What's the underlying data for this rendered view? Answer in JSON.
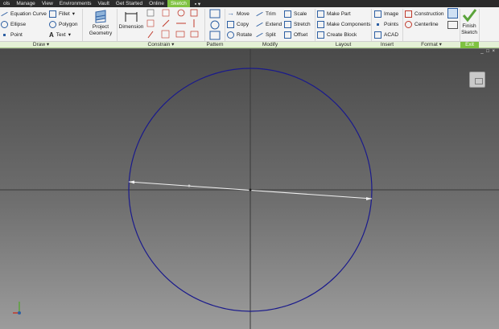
{
  "menu": {
    "tabs": [
      {
        "label": "ols",
        "active": false
      },
      {
        "label": "Manage",
        "active": false
      },
      {
        "label": "View",
        "active": false
      },
      {
        "label": "Environments",
        "active": false
      },
      {
        "label": "Vault",
        "active": false
      },
      {
        "label": "Get Started",
        "active": false
      },
      {
        "label": "Online",
        "active": false
      },
      {
        "label": "Sketch",
        "active": true
      }
    ],
    "qat_label": "▪ ▾"
  },
  "ribbon": {
    "draw": {
      "equation_curve": "Equation Curve",
      "fillet": "Fillet",
      "ellipse": "Ellipse",
      "polygon": "Polygon",
      "point": "Point",
      "text": "Text",
      "dropdown": "▾"
    },
    "project_geometry": "Project Geometry",
    "dimension": "Dimension",
    "modify": {
      "move": "Move",
      "trim": "Trim",
      "scale": "Scale",
      "copy": "Copy",
      "extend": "Extend",
      "stretch": "Stretch",
      "rotate": "Rotate",
      "split": "Split",
      "offset": "Offset"
    },
    "layout": {
      "make_part": "Make Part",
      "make_components": "Make Components",
      "create_block": "Create Block"
    },
    "insert": {
      "image": "Image",
      "points": "Points",
      "acad": "ACAD"
    },
    "format": {
      "construction": "Construction",
      "centerline": "Centerline"
    },
    "exit": {
      "finish_sketch": "Finish Sketch"
    }
  },
  "panels": [
    {
      "label": "Draw ▾",
      "active": false
    },
    {
      "label": "Constrain ▾",
      "active": false
    },
    {
      "label": "Pattern",
      "active": false
    },
    {
      "label": "Modify",
      "active": false
    },
    {
      "label": "Layout",
      "active": false
    },
    {
      "label": "Insert",
      "active": false
    },
    {
      "label": "Format ▾",
      "active": false
    },
    {
      "label": "Exit",
      "active": true
    }
  ],
  "canvas": {
    "window_controls": "_ □ ×",
    "colors": {
      "circle": "#1a1a8c",
      "axis": "#3a3a3a",
      "dimension_line": "#f0f0f0",
      "accent": "#7fc241"
    }
  }
}
